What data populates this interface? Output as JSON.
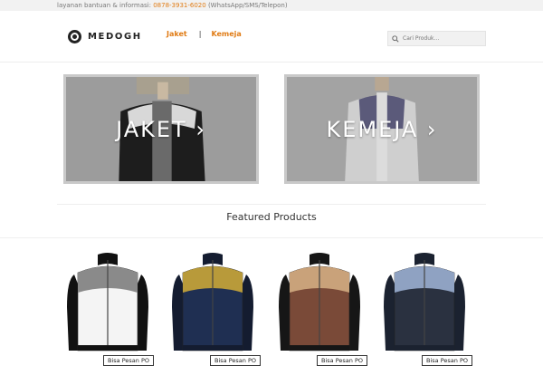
{
  "topbar": {
    "info_label": "layanan bantuan & informasi:",
    "phone": "0878-3931-6020",
    "contact_methods": "(WhatsApp/SMS/Telepon)"
  },
  "header": {
    "logo_text": "MEDOGH",
    "nav": {
      "jaket": "Jaket",
      "separator": "|",
      "kemeja": "Kemeja"
    },
    "search_placeholder": "Cari Produk..."
  },
  "banners": [
    {
      "label": "JAKET ›"
    },
    {
      "label": "KEMEJA ›"
    }
  ],
  "featured_title": "Featured Products",
  "products": [
    {
      "badge": "Bisa Pesan PO",
      "body_color": "#f4f4f4",
      "trim_color": "#111111",
      "batik_color": "#8a8a8a"
    },
    {
      "badge": "Bisa Pesan PO",
      "body_color": "#1f2f52",
      "trim_color": "#141c30",
      "batik_color": "#b89a3a"
    },
    {
      "badge": "Bisa Pesan PO",
      "body_color": "#7a4a38",
      "trim_color": "#161616",
      "batik_color": "#c9a27a"
    },
    {
      "badge": "Bisa Pesan PO",
      "body_color": "#2a3140",
      "trim_color": "#1b2230",
      "batik_color": "#8fa2c2"
    }
  ],
  "colors": {
    "accent": "#e07b14"
  }
}
